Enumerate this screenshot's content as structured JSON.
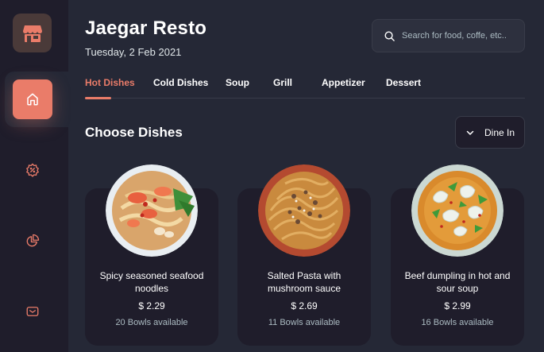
{
  "app": {
    "title": "Jaegar Resto",
    "date": "Tuesday, 2 Feb 2021"
  },
  "sidebar": {
    "items": [
      {
        "icon": "home-icon",
        "active": true
      },
      {
        "icon": "discount-icon",
        "active": false
      },
      {
        "icon": "dashboard-icon",
        "active": false
      },
      {
        "icon": "message-icon",
        "active": false
      }
    ]
  },
  "search": {
    "placeholder": "Search for food, coffe, etc.."
  },
  "tabs": [
    {
      "label": "Hot Dishes",
      "active": true
    },
    {
      "label": "Cold Dishes",
      "active": false
    },
    {
      "label": "Soup",
      "active": false
    },
    {
      "label": "Grill",
      "active": false
    },
    {
      "label": "Appetizer",
      "active": false
    },
    {
      "label": "Dessert",
      "active": false
    }
  ],
  "section": {
    "title": "Choose Dishes",
    "dine_label": "Dine In"
  },
  "dishes": [
    {
      "name": "Spicy seasoned seafood noodles",
      "price": "$ 2.29",
      "availability": "20 Bowls available"
    },
    {
      "name": "Salted Pasta with mushroom sauce",
      "price": "$ 2.69",
      "availability": "11 Bowls available"
    },
    {
      "name": "Beef dumpling in hot and sour soup",
      "price": "$ 2.99",
      "availability": "16 Bowls available"
    }
  ],
  "colors": {
    "accent": "#ea7c69",
    "background": "#252836",
    "surface": "#1f1d2b",
    "muted_text": "#abbbc2"
  }
}
